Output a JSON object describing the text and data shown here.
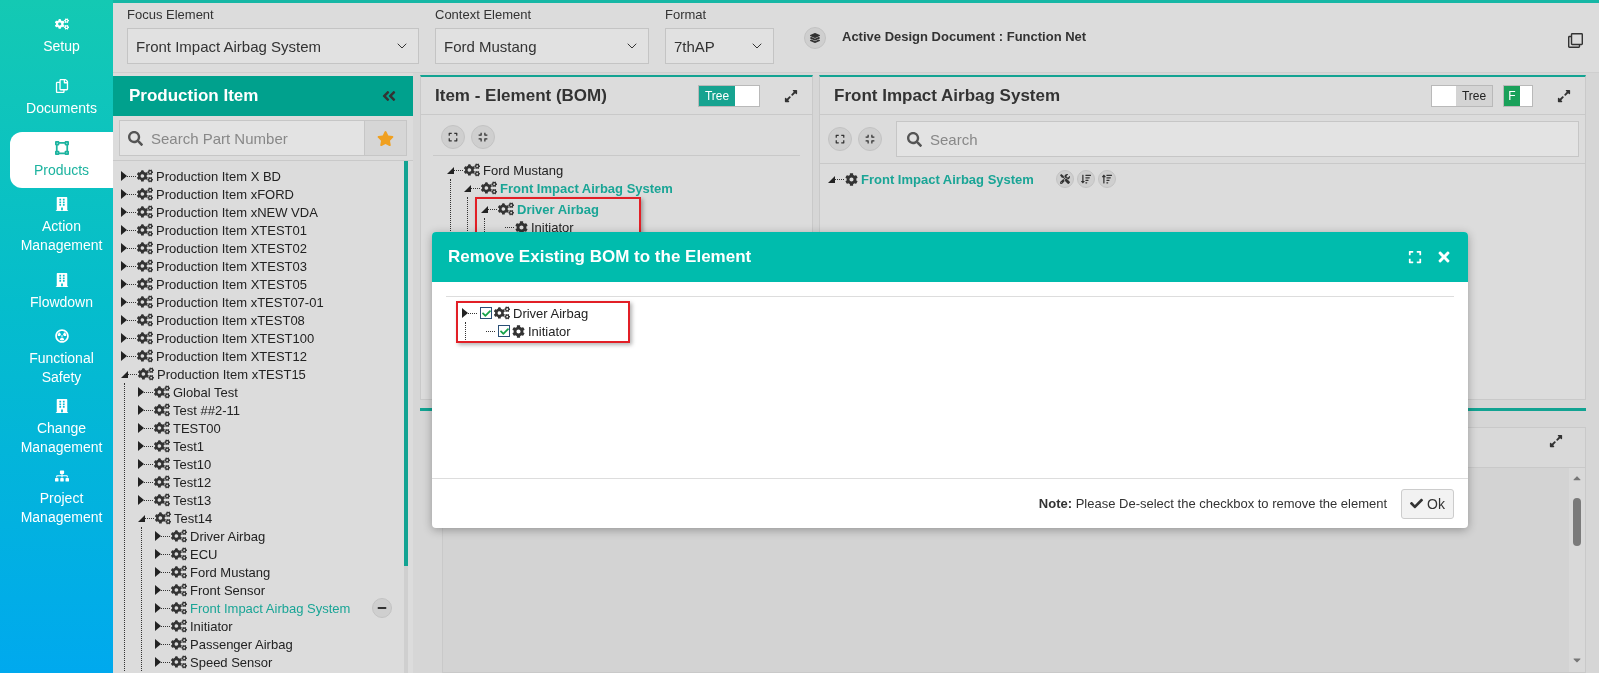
{
  "sidebar": {
    "items": [
      {
        "label": "Setup",
        "kind": "cogs",
        "selected": false
      },
      {
        "label": "Documents",
        "kind": "copy",
        "selected": false
      },
      {
        "label": "Products",
        "kind": "products",
        "selected": true
      },
      {
        "label": "Action Management",
        "kind": "building",
        "selected": false
      },
      {
        "label": "Flowdown",
        "kind": "building",
        "selected": false
      },
      {
        "label": "Functional Safety",
        "kind": "radiation",
        "selected": false
      },
      {
        "label": "Change Management",
        "kind": "building",
        "selected": false
      },
      {
        "label": "Project Management",
        "kind": "sitemap",
        "selected": false
      }
    ]
  },
  "top_bar": {
    "fields": [
      {
        "label": "Focus Element",
        "value": "Front Impact Airbag System"
      },
      {
        "label": "Context Element",
        "value": "Ford Mustang"
      },
      {
        "label": "Format",
        "value": "7thAP"
      }
    ],
    "active_document": "Active Design Document : Function Net"
  },
  "production_panel": {
    "title": "Production Item",
    "search": {
      "placeholder": "Search Part Number"
    },
    "tree": [
      {
        "label": "Production Item X BD",
        "expanded": false,
        "selected": false
      },
      {
        "label": "Production Item xFORD",
        "expanded": false,
        "selected": false
      },
      {
        "label": "Production Item xNEW VDA",
        "expanded": false,
        "selected": false
      },
      {
        "label": "Production Item XTEST01",
        "expanded": false,
        "selected": false
      },
      {
        "label": "Production Item XTEST02",
        "expanded": false,
        "selected": false
      },
      {
        "label": "Production Item XTEST03",
        "expanded": false,
        "selected": false
      },
      {
        "label": "Production Item XTEST05",
        "expanded": false,
        "selected": false
      },
      {
        "label": "Production Item xTEST07-01",
        "expanded": false,
        "selected": false
      },
      {
        "label": "Production Item xTEST08",
        "expanded": false,
        "selected": false
      },
      {
        "label": "Production Item XTEST100",
        "expanded": false,
        "selected": false
      },
      {
        "label": "Production Item XTEST12",
        "expanded": false,
        "selected": false
      },
      {
        "label": "Production Item xTEST15",
        "expanded": true,
        "selected": false,
        "children": [
          {
            "label": "Global Test",
            "expanded": false,
            "selected": false
          },
          {
            "label": "Test ##2-11",
            "expanded": false,
            "selected": false
          },
          {
            "label": "TEST00",
            "expanded": false,
            "selected": false
          },
          {
            "label": "Test1",
            "expanded": false,
            "selected": false
          },
          {
            "label": "Test10",
            "expanded": false,
            "selected": false
          },
          {
            "label": "Test12",
            "expanded": false,
            "selected": false
          },
          {
            "label": "Test13",
            "expanded": false,
            "selected": false
          },
          {
            "label": "Test14",
            "expanded": true,
            "selected": false,
            "children": [
              {
                "label": "Driver Airbag",
                "expanded": false,
                "selected": false
              },
              {
                "label": "ECU",
                "expanded": false,
                "selected": false
              },
              {
                "label": "Ford Mustang",
                "expanded": false,
                "selected": false
              },
              {
                "label": "Front Sensor",
                "expanded": false,
                "selected": false
              },
              {
                "label": "Front Impact Airbag System",
                "expanded": false,
                "selected": true
              },
              {
                "label": "Initiator",
                "expanded": false,
                "selected": false
              },
              {
                "label": "Passenger Airbag",
                "expanded": false,
                "selected": false
              },
              {
                "label": "Speed Sensor",
                "expanded": false,
                "selected": false
              }
            ]
          }
        ]
      }
    ]
  },
  "bom_panel": {
    "title": "Item - Element (BOM)",
    "tree_toggle": {
      "label": "Tree",
      "on": true
    },
    "tree": [
      {
        "label": "Ford Mustang",
        "kind": "assembly",
        "expanded": true,
        "selected": false,
        "children": [
          {
            "label": "Front Impact Airbag System",
            "kind": "assembly",
            "expanded": true,
            "selected": true,
            "children": [
              {
                "label": "Driver Airbag",
                "kind": "assembly",
                "expanded": true,
                "selected": true,
                "annotated": true,
                "children": [
                  {
                    "label": "Initiator",
                    "kind": "part",
                    "selected": false
                  }
                ]
              }
            ]
          }
        ]
      }
    ]
  },
  "function_panel": {
    "title": "Front Impact Airbag System",
    "tree_toggle": {
      "label": "Tree",
      "on": false
    },
    "f_toggle": {
      "label": "F",
      "on": true
    },
    "search": {
      "placeholder": "Search"
    },
    "tree": [
      {
        "label": "Front Impact Airbag System",
        "kind": "part",
        "expanded": true,
        "selected": true
      }
    ]
  },
  "dialog": {
    "title": "Remove Existing BOM to the Element",
    "tree": [
      {
        "label": "Driver Airbag",
        "kind": "assembly",
        "expanded": false,
        "checked": true,
        "selected": false,
        "annotated": true,
        "children": [
          {
            "label": "Initiator",
            "kind": "part",
            "checked": true,
            "selected": false
          }
        ]
      }
    ],
    "note": "**Note:** Please De-select the checkbox to remove the element",
    "ok_button": "Ok"
  }
}
